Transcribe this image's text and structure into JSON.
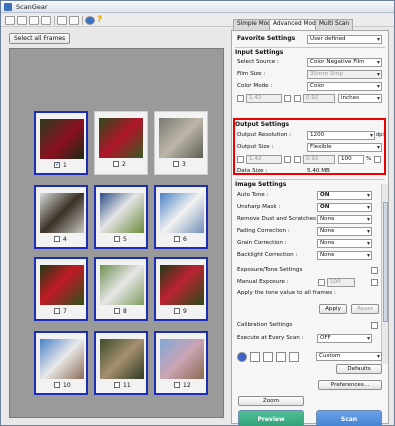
{
  "app": {
    "title": "ScanGear"
  },
  "left": {
    "select_all_label": "Select all Frames",
    "frames": [
      {
        "number": "1",
        "checked": true,
        "selected": true
      },
      {
        "number": "2",
        "checked": false,
        "selected": false
      },
      {
        "number": "3",
        "checked": false,
        "selected": false
      },
      {
        "number": "4",
        "checked": false,
        "selected": true
      },
      {
        "number": "5",
        "checked": false,
        "selected": true
      },
      {
        "number": "6",
        "checked": false,
        "selected": true
      },
      {
        "number": "7",
        "checked": false,
        "selected": true
      },
      {
        "number": "8",
        "checked": false,
        "selected": true
      },
      {
        "number": "9",
        "checked": false,
        "selected": true
      },
      {
        "number": "10",
        "checked": false,
        "selected": true
      },
      {
        "number": "11",
        "checked": false,
        "selected": true
      },
      {
        "number": "12",
        "checked": false,
        "selected": true
      }
    ]
  },
  "tabs": [
    "Simple Mode",
    "Advanced Mode",
    "Multi Scan"
  ],
  "favorite": {
    "label": "Favorite Settings",
    "value": "User defined"
  },
  "input": {
    "heading": "Input Settings",
    "source_label": "Select Source :",
    "source_value": "Color Negative Film",
    "film_size_label": "Film Size :",
    "film_size_value": "35mm Strip",
    "color_mode_label": "Color Mode :",
    "color_mode_value": "Color",
    "width": "1.42",
    "height": "0.92",
    "unit": "inches"
  },
  "output": {
    "heading": "Output Settings",
    "resolution_label": "Output Resolution :",
    "resolution_value": "1200",
    "resolution_unit": "dpi",
    "size_label": "Output Size :",
    "size_value": "Flexible",
    "width": "1.42",
    "height": "0.92",
    "percent": "100",
    "percent_unit": "%",
    "data_size_label": "Data Size :",
    "data_size_value": "5.40 MB"
  },
  "image": {
    "heading": "Image Settings",
    "rows": [
      {
        "label": "Auto Tone :",
        "value": "ON",
        "bold": true
      },
      {
        "label": "Unsharp Mask :",
        "value": "ON",
        "bold": true
      },
      {
        "label": "Remove Dust and Scratches :",
        "value": "None",
        "bold": false
      },
      {
        "label": "Fading Correction :",
        "value": "None",
        "bold": false
      },
      {
        "label": "Grain Correction :",
        "value": "None",
        "bold": false
      },
      {
        "label": "Backlight Correction :",
        "value": "None",
        "bold": false
      }
    ],
    "tone_heading": "Exposure/Tone Settings",
    "manual_exposure_label": "Manual Exposure :",
    "manual_exposure_value": "100",
    "apply_text": "Apply the tone value to all frames :",
    "apply_label": "Apply",
    "reset_label": "Reset",
    "calib_heading": "Calibration Settings",
    "execute_label": "Execute at Every Scan :",
    "execute_value": "OFF"
  },
  "bottom": {
    "custom_value": "Custom",
    "defaults_label": "Defaults",
    "preferences_label": "Preferences...",
    "zoom_label": "Zoom",
    "preview_label": "Preview",
    "scan_label": "Scan"
  },
  "colors": {
    "accent": "#1c2db8",
    "highlight": "#e00000",
    "preview_btn": "#2f9a74",
    "scan_btn": "#3f7fd0"
  }
}
